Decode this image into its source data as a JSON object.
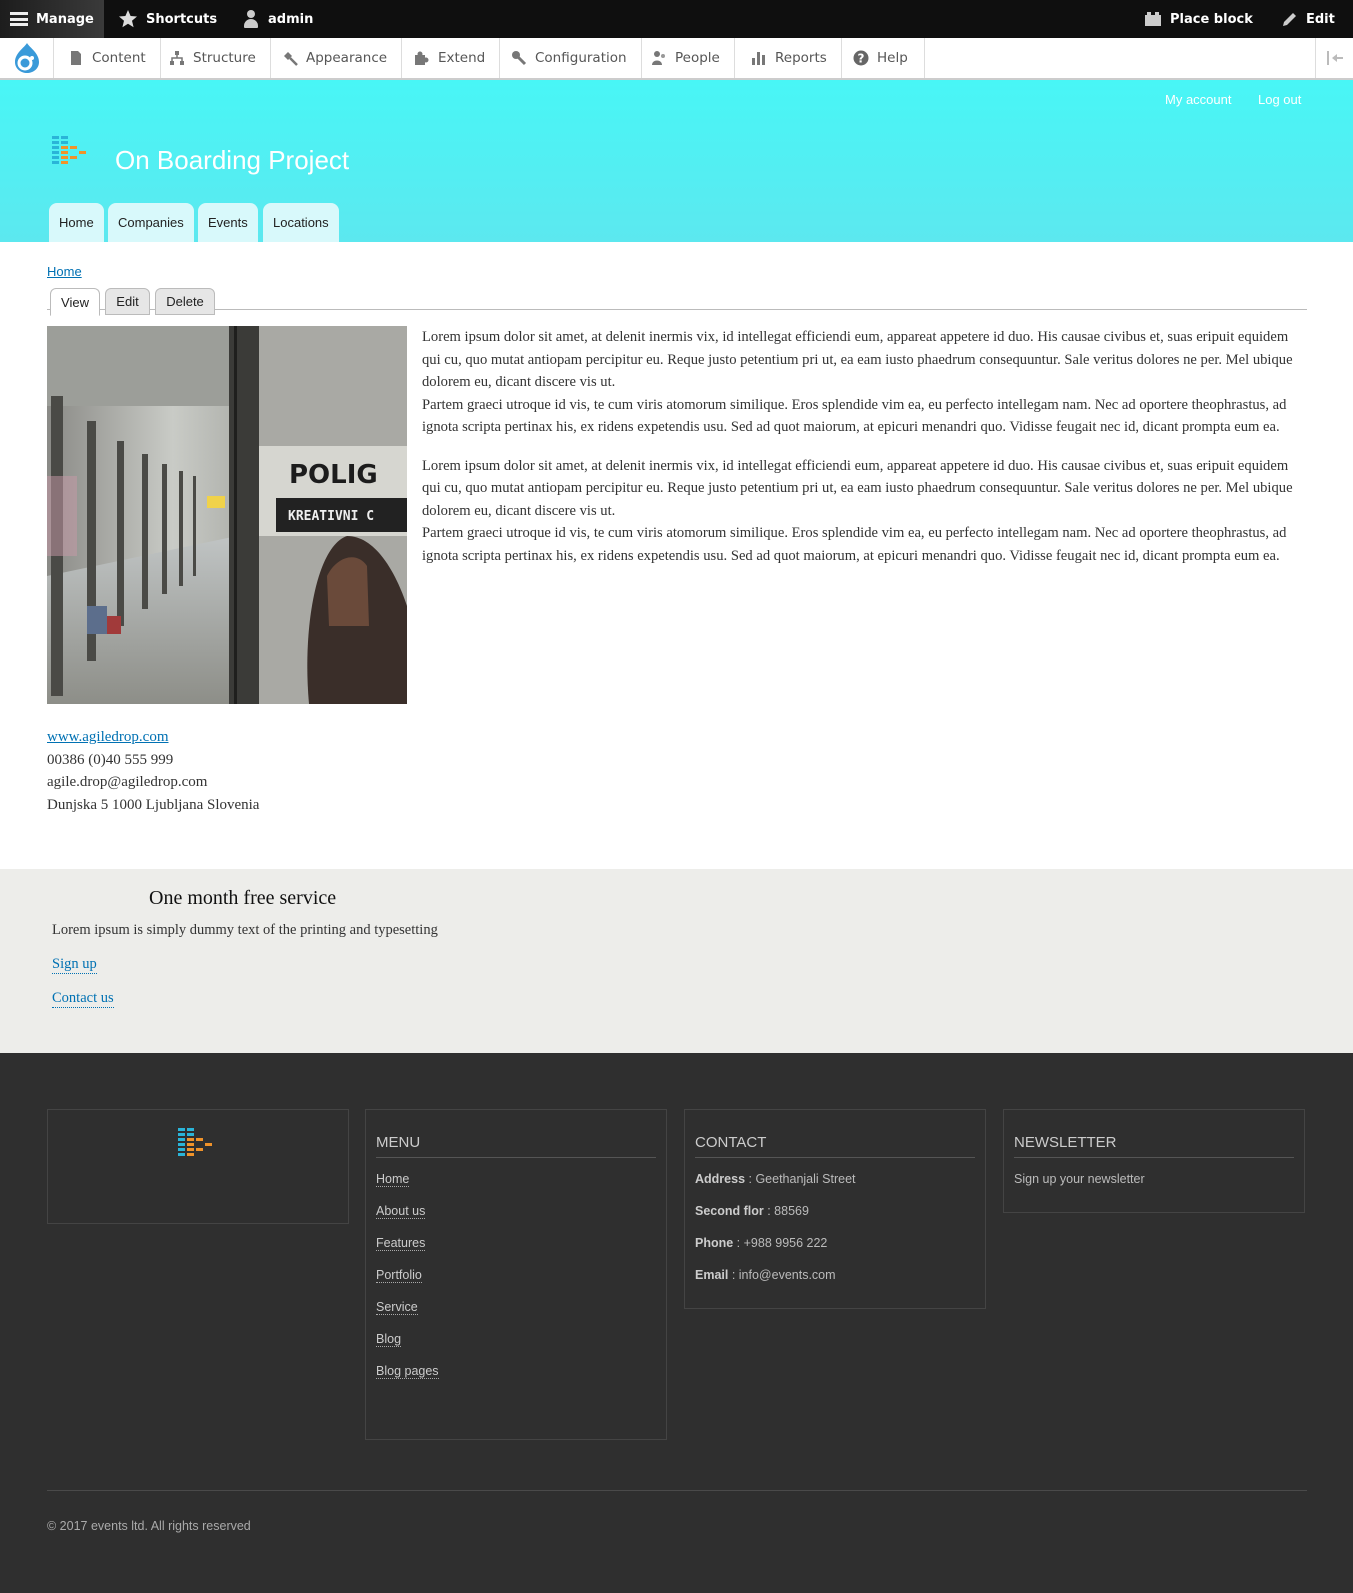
{
  "toolbar": {
    "manage": "Manage",
    "shortcuts": "Shortcuts",
    "user": "admin",
    "place_block": "Place block",
    "edit": "Edit"
  },
  "tray": {
    "items": [
      {
        "label": "Content",
        "icon": "file-icon"
      },
      {
        "label": "Structure",
        "icon": "sitemap-icon"
      },
      {
        "label": "Appearance",
        "icon": "paintbrush-icon"
      },
      {
        "label": "Extend",
        "icon": "puzzle-icon"
      },
      {
        "label": "Configuration",
        "icon": "wrench-icon"
      },
      {
        "label": "People",
        "icon": "people-icon"
      },
      {
        "label": "Reports",
        "icon": "bar-chart-icon"
      },
      {
        "label": "Help",
        "icon": "help-icon"
      }
    ]
  },
  "header": {
    "my_account": "My account",
    "log_out": "Log out",
    "site_name": "On Boarding Project",
    "main_tabs": [
      "Home",
      "Companies",
      "Events",
      "Locations"
    ]
  },
  "page": {
    "breadcrumb": "Home",
    "local_tabs": [
      "View",
      "Edit",
      "Delete"
    ],
    "photo_sign_1": "POLIG",
    "photo_sign_2": "KREATIVNI C",
    "paragraphs": [
      "Lorem ipsum dolor sit amet, at delenit inermis vix, id intellegat efficiendi eum, appareat appetere id duo. His causae civibus et, suas eripuit equidem qui cu, quo mutat antiopam percipitur eu. Reque justo petentium pri ut, ea eam iusto phaedrum consequuntur. Sale veritus dolores ne per. Mel ubique dolorem eu, dicant discere vis ut.",
      "Partem graeci utroque id vis, te cum viris atomorum similique. Eros splendide vim ea, eu perfecto intellegam nam. Nec ad oportere theophrastus, ad ignota scripta pertinax his, ex ridens expetendis usu. Sed ad quot maiorum, at epicuri menandri quo. Vidisse feugait nec id, dicant prompta eum ea.",
      "Lorem ipsum dolor sit amet, at delenit inermis vix, id intellegat efficiendi eum, appareat appetere id duo. His causae civibus et, suas eripuit equidem qui cu, quo mutat antiopam percipitur eu. Reque justo petentium pri ut, ea eam iusto phaedrum consequuntur. Sale veritus dolores ne per. Mel ubique dolorem eu, dicant discere vis ut.",
      "Partem graeci utroque id vis, te cum viris atomorum similique. Eros splendide vim ea, eu perfecto intellegam nam. Nec ad oportere theophrastus, ad ignota scripta pertinax his, ex ridens expetendis usu. Sed ad quot maiorum, at epicuri menandri quo. Vidisse feugait nec id, dicant prompta eum ea."
    ],
    "website": "www.agiledrop.com",
    "phone": "00386 (0)40 555 999",
    "email": "agile.drop@agiledrop.com",
    "address": "Dunjska 5 1000 Ljubljana Slovenia"
  },
  "promo": {
    "title": "One month free service",
    "text": "Lorem ipsum is simply dummy text of the printing and typesetting",
    "sign_up": "Sign up",
    "contact_us": "Contact us"
  },
  "footer": {
    "menu_title": "MENU",
    "menu": [
      "Home",
      "About us",
      "Features",
      "Portfolio",
      "Service",
      "Blog",
      "Blog pages"
    ],
    "contact_title": "CONTACT",
    "contact": [
      {
        "label": "Address",
        "value": " : Geethanjali Street"
      },
      {
        "label": "Second flor",
        "value": " : 88569"
      },
      {
        "label": "Phone",
        "value": " : +988 9956 222"
      },
      {
        "label": "Email",
        "value": " : info@events.com"
      }
    ],
    "newsletter_title": "NEWSLETTER",
    "newsletter_text": "Sign up your newsletter",
    "copyright": "© 2017 events ltd. All rights reserved"
  },
  "colors": {
    "header_cyan": "#48f6f6",
    "link_blue": "#0071b3",
    "footer_bg": "#2f2f2f",
    "promo_bg": "#ededea",
    "logo_blue": "#2ab4d8",
    "logo_orange": "#f0932a"
  }
}
